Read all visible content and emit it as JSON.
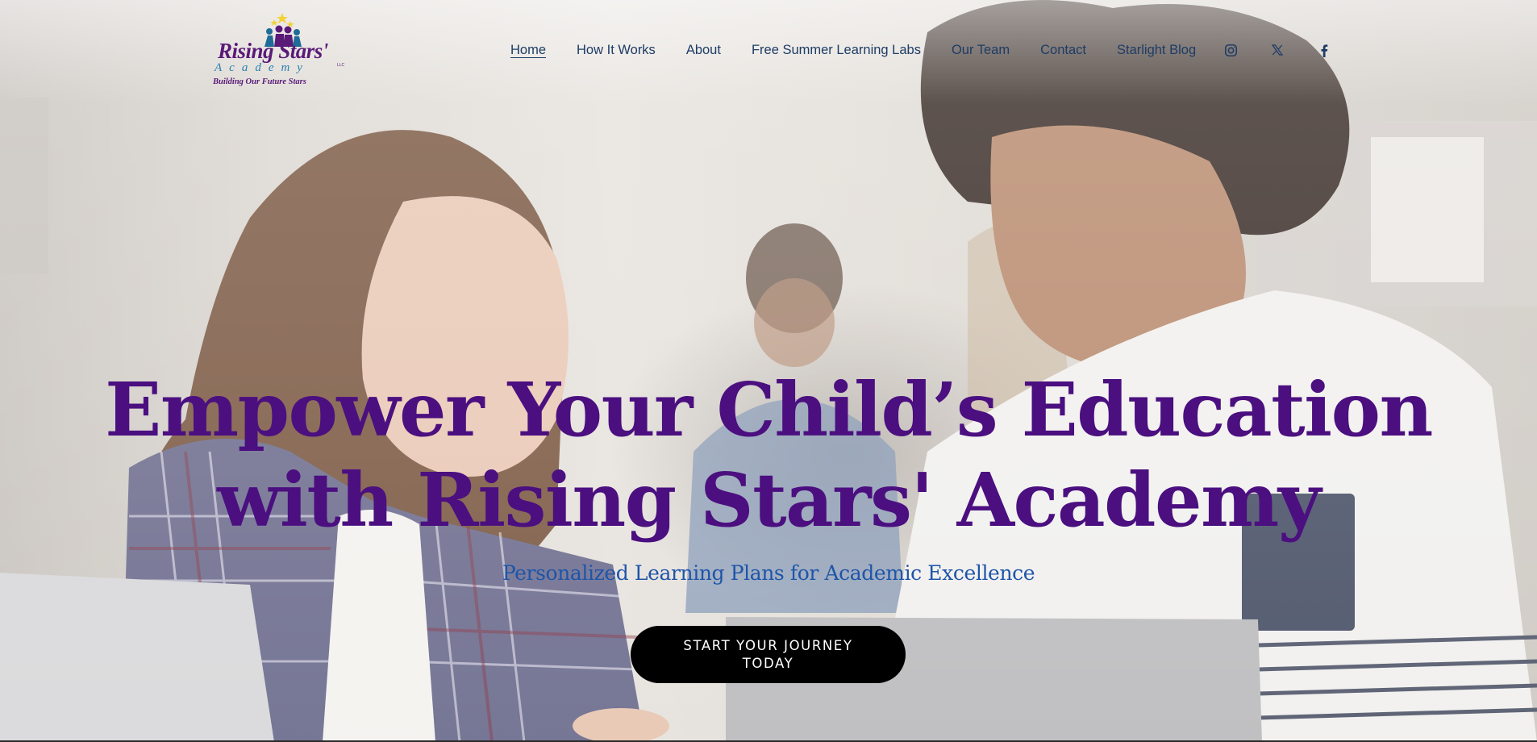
{
  "brand": {
    "logo_name": "Rising Stars'",
    "logo_academy": "Academy",
    "logo_llc": "LLC",
    "logo_tagline": "Building Our Future Stars",
    "colors": {
      "primary": "#4b0f80",
      "nav": "#1d3c66",
      "subtitle": "#1e55a8",
      "cta_bg": "#000000"
    }
  },
  "nav": {
    "items": [
      {
        "label": "Home",
        "active": true
      },
      {
        "label": "How It Works"
      },
      {
        "label": "About"
      },
      {
        "label": "Free Summer Learning Labs"
      },
      {
        "label": "Our Team"
      },
      {
        "label": "Contact"
      },
      {
        "label": "Starlight Blog"
      }
    ],
    "social": [
      {
        "icon": "instagram-icon"
      },
      {
        "icon": "x-twitter-icon"
      },
      {
        "icon": "facebook-icon"
      }
    ]
  },
  "hero": {
    "title_line1": "Empower Your Child’s Education",
    "title_line2": "with Rising Stars' Academy",
    "subtitle": "Personalized Learning Plans for Academic Excellence",
    "cta_label": "START YOUR JOURNEY TODAY",
    "background_image": "two-students-at-laptops-photo"
  }
}
